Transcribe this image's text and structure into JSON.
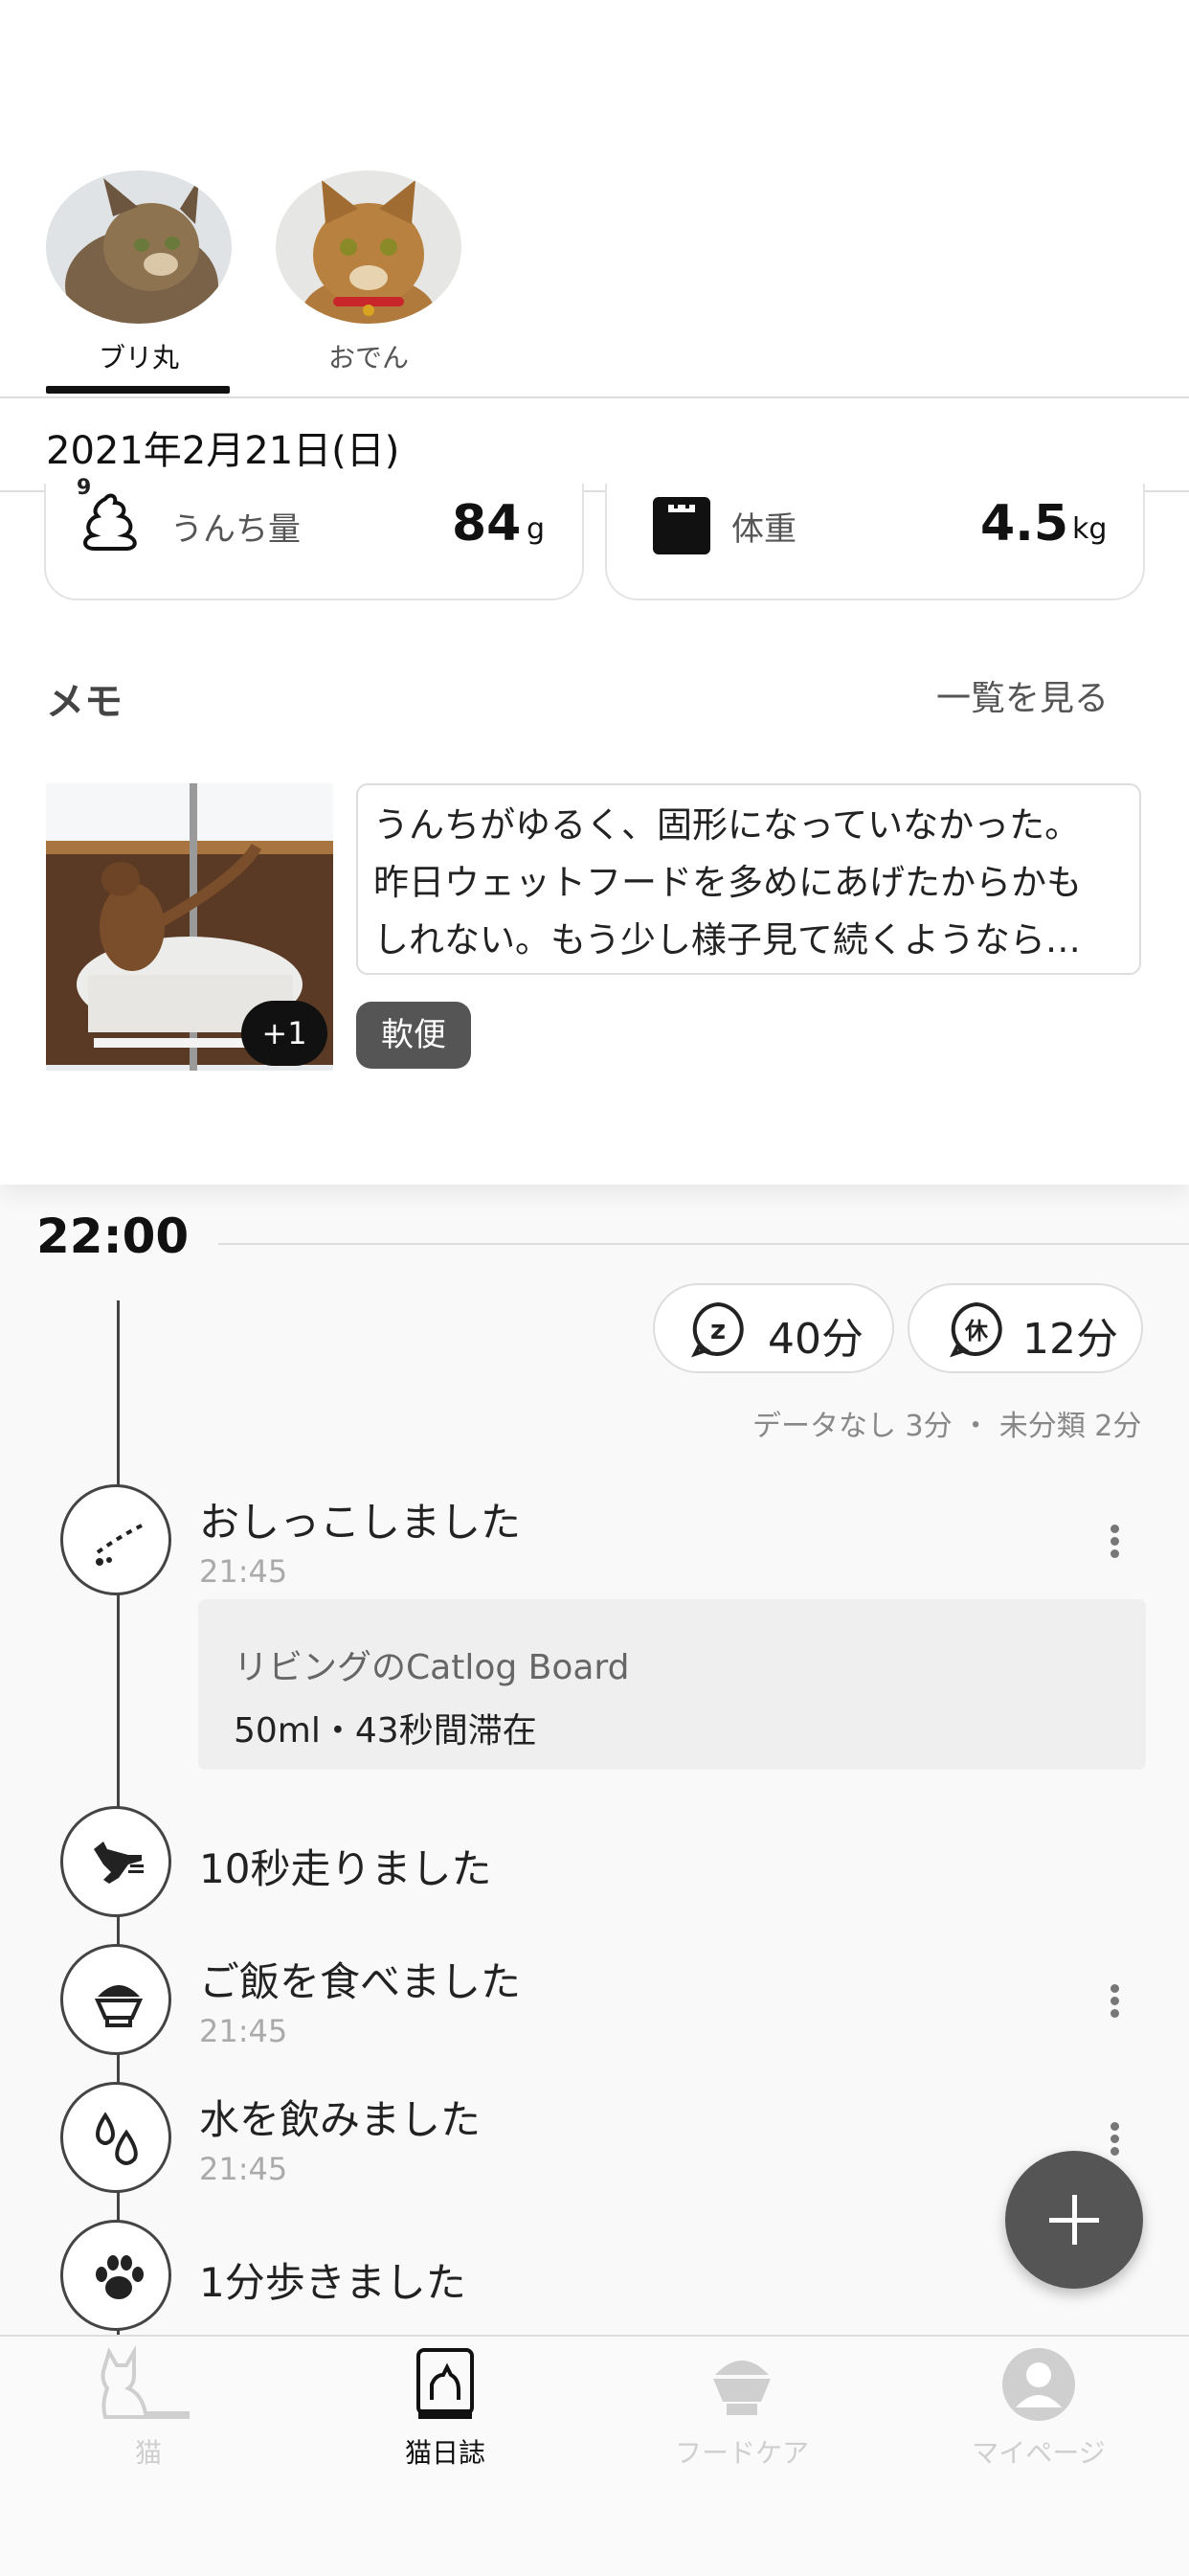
{
  "cats": [
    {
      "name": "ブリ丸",
      "selected": true
    },
    {
      "name": "おでん",
      "selected": false
    }
  ],
  "date": "2021年2月21日(日)",
  "stats": {
    "poop": {
      "label": "うんち量",
      "value": "84",
      "unit": "g",
      "icon_count": "9"
    },
    "weight": {
      "label": "体重",
      "value": "4.5",
      "unit": "kg"
    }
  },
  "memo": {
    "title": "メモ",
    "view_all": "一覧を見る",
    "photo_badge": "+1",
    "text_lines": [
      "うんちがゆるく、固形になっていなかった。",
      "昨日ウェットフードを多めにあげたからかも",
      "しれない。もう少し様子見て続くようなら…"
    ],
    "tag": "軟便"
  },
  "timeline": {
    "time": "22:00",
    "sleep": "40分",
    "rest": "12分",
    "sleep_icon_char": "z",
    "rest_icon_char": "休",
    "note": "データなし 3分 ・ 未分類 2分",
    "events": [
      {
        "title": "おしっこしました",
        "time": "21:45",
        "icon": "pee-icon"
      },
      {
        "title": "10秒走りました",
        "time": "",
        "icon": "running-cat-icon"
      },
      {
        "title": "ご飯を食べました",
        "time": "21:45",
        "icon": "food-bowl-icon"
      },
      {
        "title": "水を飲みました",
        "time": "21:45",
        "icon": "water-drop-icon"
      },
      {
        "title": "1分歩きました",
        "time": "",
        "icon": "paw-icon"
      }
    ],
    "detail": {
      "device": "リビングのCatlog Board",
      "info": "50ml・43秒間滞在"
    }
  },
  "nav": [
    {
      "label": "猫",
      "active": false
    },
    {
      "label": "猫日誌",
      "active": true
    },
    {
      "label": "フードケア",
      "active": false
    },
    {
      "label": "マイページ",
      "active": false
    }
  ],
  "colors": {
    "active": "#111111",
    "inactive": "#cfcfcf",
    "fab": "#555555"
  }
}
